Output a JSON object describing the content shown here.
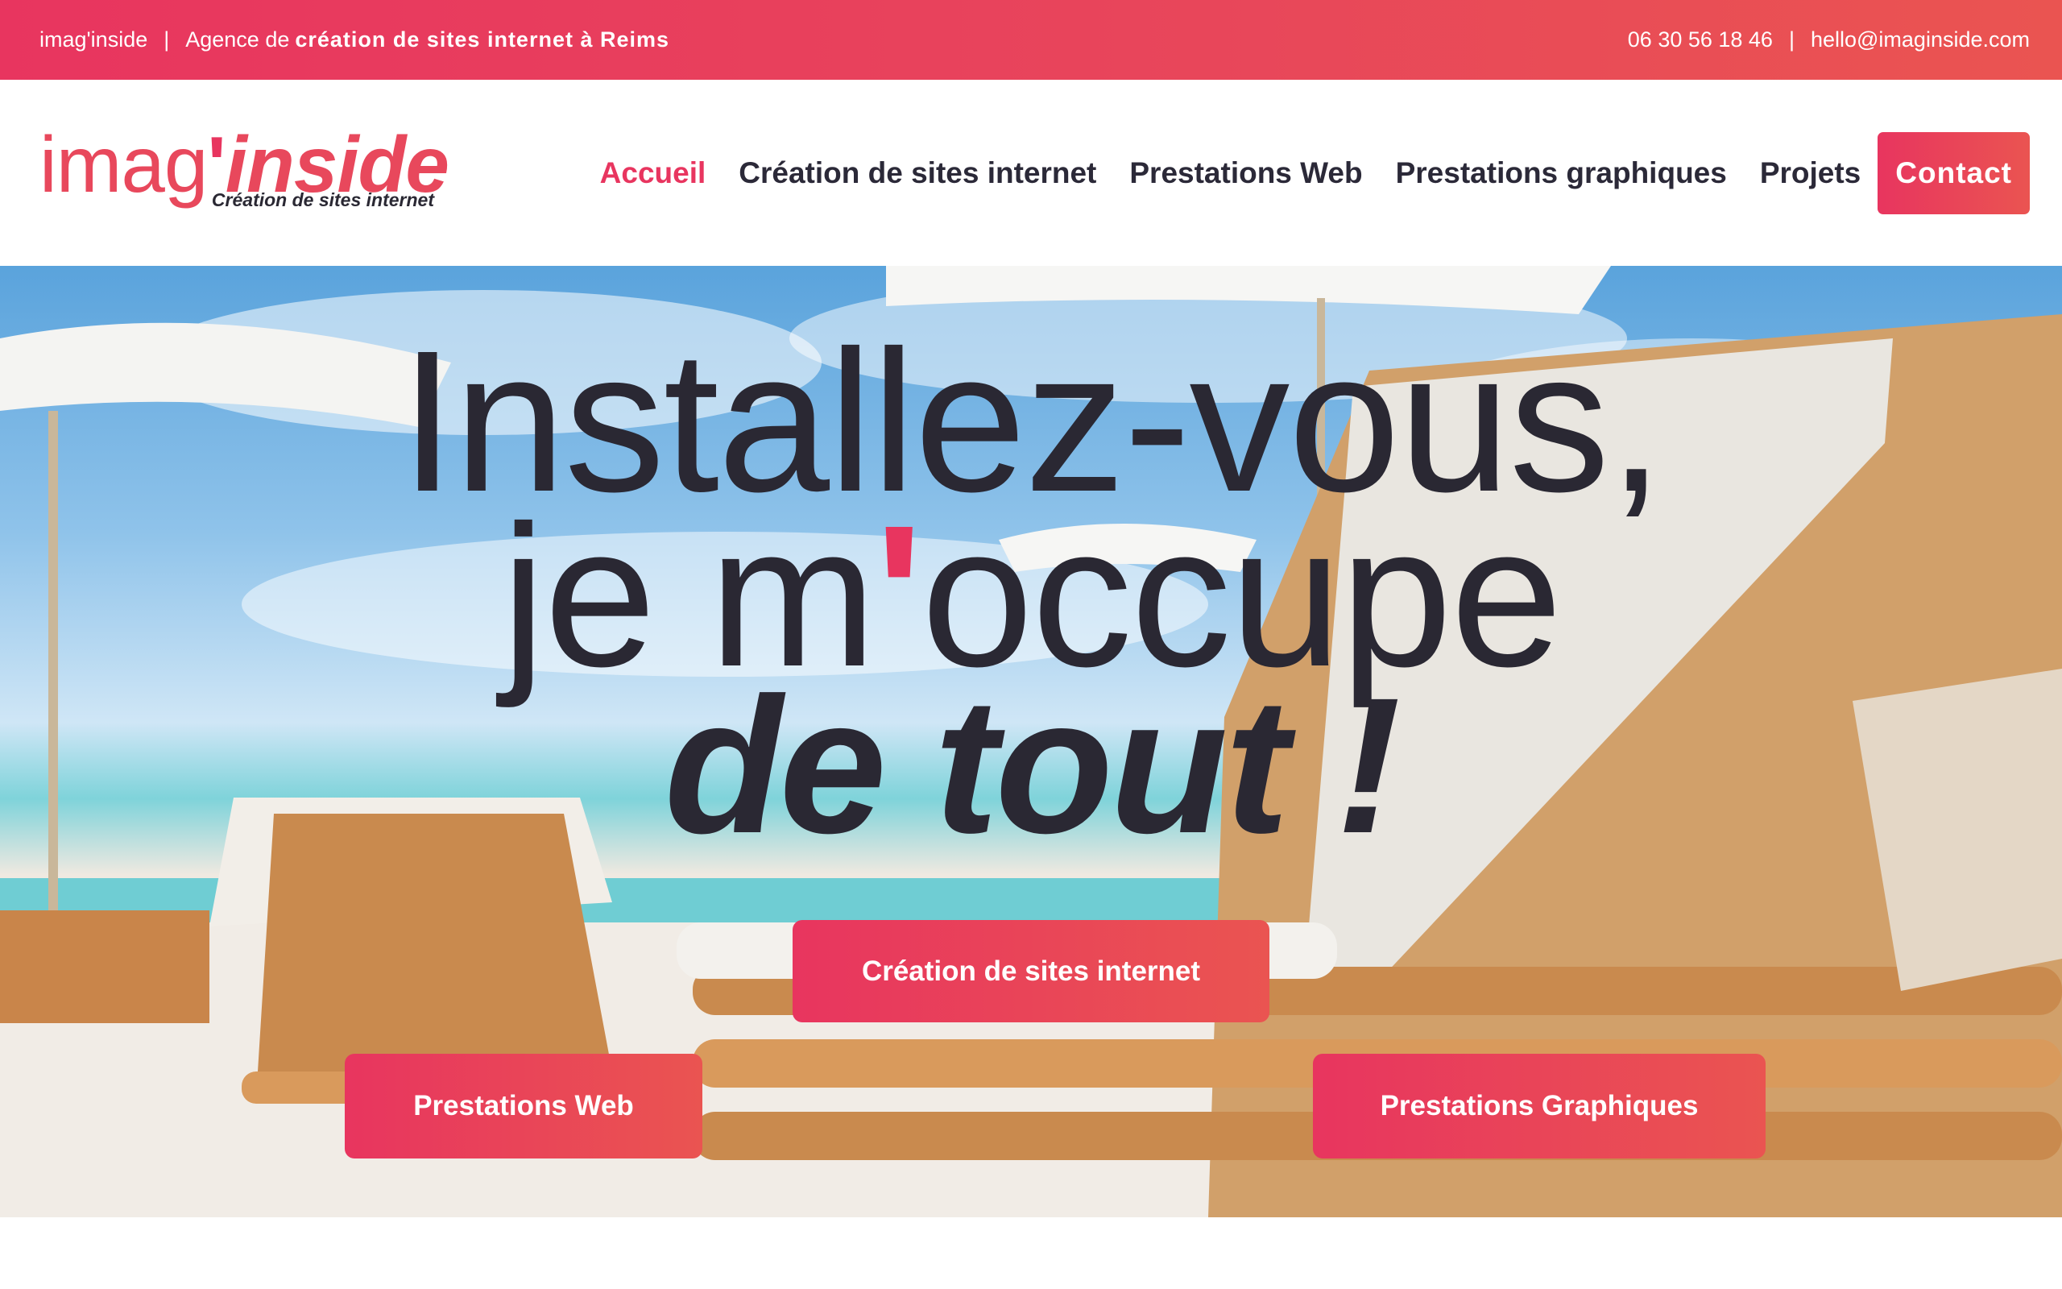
{
  "topbar": {
    "brand": "imag'inside",
    "separator": "|",
    "agency_prefix": "Agence de",
    "agency_bold": "création de sites internet à Reims",
    "phone": "06 30 56 18 46",
    "email": "hello@imaginside.com"
  },
  "logo": {
    "light": "imag",
    "quote": "'",
    "bold": "inside",
    "tagline": "Création de sites internet"
  },
  "nav": {
    "items": [
      {
        "label": "Accueil",
        "active": true
      },
      {
        "label": "Création de sites internet",
        "active": false
      },
      {
        "label": "Prestations Web",
        "active": false
      },
      {
        "label": "Prestations graphiques",
        "active": false
      },
      {
        "label": "Projets",
        "active": false
      }
    ],
    "contact": "Contact"
  },
  "hero": {
    "line1": "Installez-vous,",
    "line2_before": "je m",
    "line2_apos": "'",
    "line2_after": "occupe",
    "line3": "de tout !",
    "buttons": {
      "creation": "Création de sites internet",
      "web": "Prestations Web",
      "graphiques": "Prestations Graphiques"
    }
  },
  "colors": {
    "accent": "#e8355f",
    "accent_end": "#ea5451",
    "text_dark": "#2a2833"
  }
}
